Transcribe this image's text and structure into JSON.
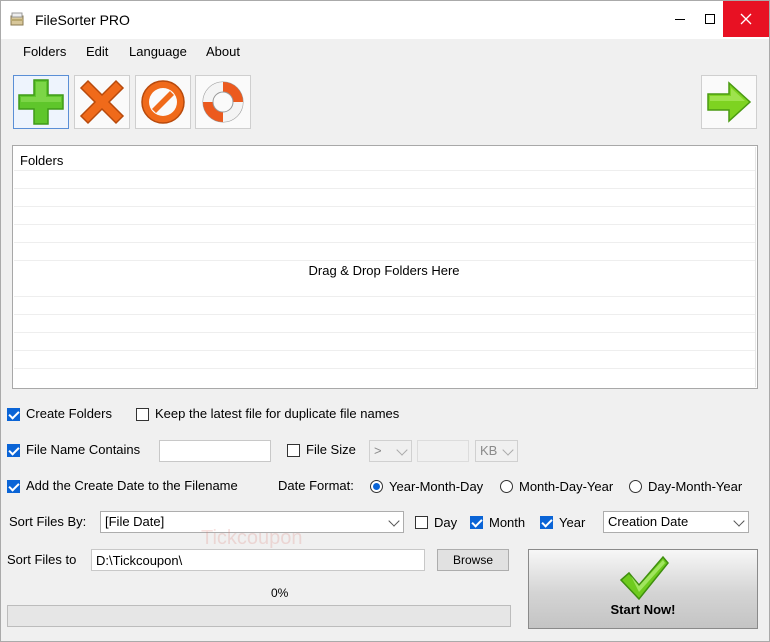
{
  "window": {
    "title": "FileSorter PRO"
  },
  "menu": {
    "items": [
      "Folders",
      "Edit",
      "Language",
      "About"
    ]
  },
  "toolbar": {
    "icons": [
      "add-folder-icon",
      "remove-folder-icon",
      "clear-list-icon",
      "help-icon",
      "next-arrow-icon"
    ]
  },
  "folders": {
    "header": "Folders",
    "drop_hint": "Drag & Drop Folders Here"
  },
  "options": {
    "create_folders": {
      "label": "Create Folders",
      "checked": true
    },
    "keep_latest": {
      "label": "Keep the latest file for duplicate file names",
      "checked": false
    },
    "file_name_contains": {
      "label": "File Name Contains",
      "checked": true,
      "value": ""
    },
    "file_size": {
      "label": "File Size",
      "checked": false,
      "operator": ">",
      "value": "",
      "unit": "KB"
    },
    "add_create_date": {
      "label": "Add the Create Date to the Filename",
      "checked": true
    },
    "date_format": {
      "label": "Date Format:",
      "options": [
        "Year-Month-Day",
        "Month-Day-Year",
        "Day-Month-Year"
      ],
      "selected": "Year-Month-Day"
    }
  },
  "sort_by": {
    "label": "Sort Files By:",
    "value": "[File Date]",
    "day": {
      "label": "Day",
      "checked": false
    },
    "month": {
      "label": "Month",
      "checked": true
    },
    "year": {
      "label": "Year",
      "checked": true
    },
    "date_type": "Creation Date"
  },
  "sort_to": {
    "label": "Sort Files to",
    "path": "D:\\Tickcoupon\\",
    "browse_label": "Browse"
  },
  "progress": {
    "label": "0%",
    "value": 0
  },
  "start": {
    "label": "Start Now!"
  },
  "watermark": {
    "text": "Tickcoupon"
  },
  "colors": {
    "accent": "#0a64d6",
    "close_button": "#e81123",
    "add_green": "#5fc62b",
    "remove_orange": "#f06a1a"
  }
}
